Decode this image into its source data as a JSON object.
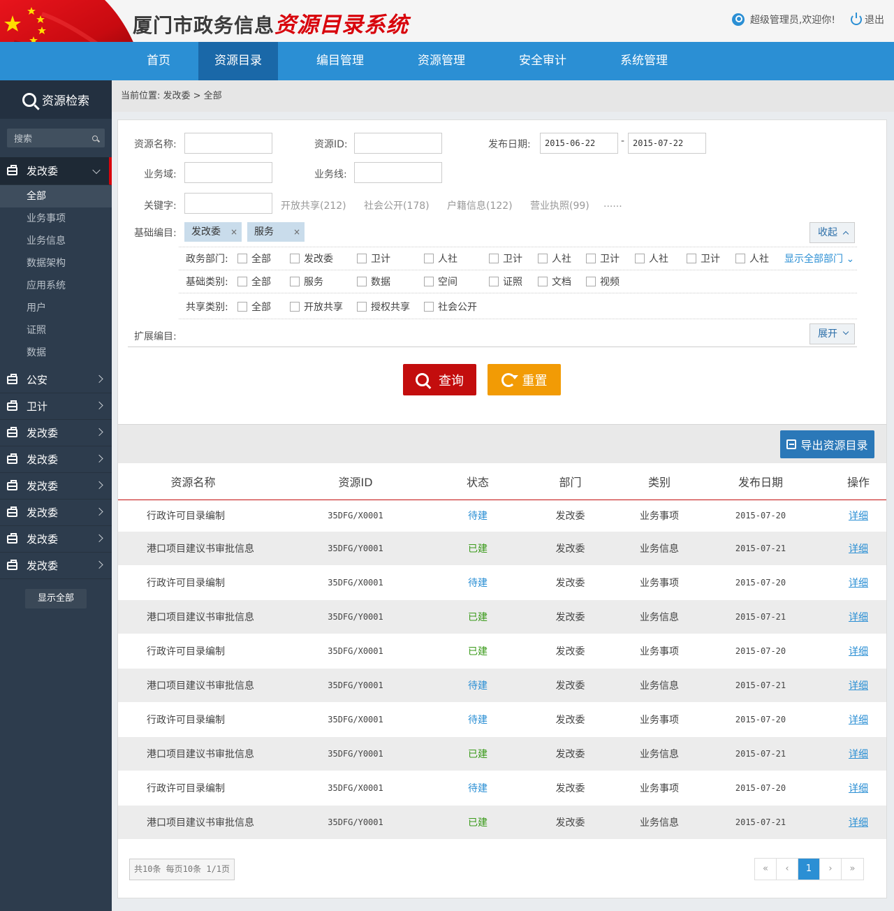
{
  "header": {
    "title_main": "厦门市政务信息",
    "title_accent": "资源目录系统",
    "user_text": "超级管理员,欢迎你!",
    "logout": "退出"
  },
  "nav": [
    "首页",
    "资源目录",
    "编目管理",
    "资源管理",
    "安全审计",
    "系统管理"
  ],
  "sidebar": {
    "title": "资源检索",
    "search_placeholder": "搜索",
    "open_group": "发改委",
    "sub_items": [
      "全部",
      "业务事项",
      "业务信息",
      "数据架构",
      "应用系统",
      "用户",
      "证照",
      "数据"
    ],
    "groups": [
      "公安",
      "卫计",
      "发改委",
      "发改委",
      "发改委",
      "发改委",
      "发改委",
      "发改委"
    ],
    "show_all": "显示全部"
  },
  "breadcrumb": "当前位置: 发改委 > 全部",
  "filters": {
    "name_label": "资源名称:",
    "id_label": "资源ID:",
    "date_label": "发布日期:",
    "date_from": "2015-06-22",
    "date_sep": "-",
    "date_to": "2015-07-22",
    "domain_label": "业务域:",
    "line_label": "业务线:",
    "keyword_label": "关键字:",
    "keywords": [
      "开放共享(212)",
      "社会公开(178)",
      "户籍信息(122)",
      "营业执照(99)",
      "......"
    ],
    "basic_label": "基础编目:",
    "chips": [
      "发改委",
      "服务"
    ],
    "chip_close": "×",
    "collapse": "收起",
    "dept_label": "政务部门:",
    "dept_options": [
      "全部",
      "发改委",
      "卫计",
      "人社",
      "卫计",
      "人社",
      "卫计",
      "人社",
      "卫计",
      "人社"
    ],
    "dept_more": "显示全部部门",
    "type_label": "基础类别:",
    "type_options": [
      "全部",
      "服务",
      "数据",
      "空间",
      "证照",
      "文档",
      "视频"
    ],
    "share_label": "共享类别:",
    "share_options": [
      "全部",
      "开放共享",
      "授权共享",
      "社会公开"
    ],
    "ext_label": "扩展编目:",
    "expand": "展开",
    "query": "查询",
    "reset": "重置"
  },
  "export": "导出资源目录",
  "table": {
    "headers": [
      "资源名称",
      "资源ID",
      "状态",
      "部门",
      "类别",
      "发布日期",
      "操作"
    ],
    "rows": [
      [
        "行政许可目录编制",
        "35DFG/X0001",
        "待建",
        "发改委",
        "业务事项",
        "2015-07-20",
        "详细"
      ],
      [
        "港口项目建议书审批信息",
        "35DFG/Y0001",
        "已建",
        "发改委",
        "业务信息",
        "2015-07-21",
        "详细"
      ],
      [
        "行政许可目录编制",
        "35DFG/X0001",
        "待建",
        "发改委",
        "业务事项",
        "2015-07-20",
        "详细"
      ],
      [
        "港口项目建议书审批信息",
        "35DFG/Y0001",
        "已建",
        "发改委",
        "业务信息",
        "2015-07-21",
        "详细"
      ],
      [
        "行政许可目录编制",
        "35DFG/X0001",
        "已建",
        "发改委",
        "业务事项",
        "2015-07-20",
        "详细"
      ],
      [
        "港口项目建议书审批信息",
        "35DFG/Y0001",
        "待建",
        "发改委",
        "业务信息",
        "2015-07-21",
        "详细"
      ],
      [
        "行政许可目录编制",
        "35DFG/X0001",
        "待建",
        "发改委",
        "业务事项",
        "2015-07-20",
        "详细"
      ],
      [
        "港口项目建议书审批信息",
        "35DFG/Y0001",
        "已建",
        "发改委",
        "业务信息",
        "2015-07-21",
        "详细"
      ],
      [
        "行政许可目录编制",
        "35DFG/X0001",
        "待建",
        "发改委",
        "业务事项",
        "2015-07-20",
        "详细"
      ],
      [
        "港口项目建议书审批信息",
        "35DFG/Y0001",
        "已建",
        "发改委",
        "业务信息",
        "2015-07-21",
        "详细"
      ]
    ]
  },
  "pagination": {
    "info": "共10条 每页10条 1/1页",
    "first": "«",
    "prev": "‹",
    "current": "1",
    "next": "›",
    "last": "»"
  },
  "colors": {
    "nav": "#2b8fd4",
    "nav_active": "#1a68a8",
    "sidebar": "#2d3c4d",
    "accent_red": "#d8040c",
    "query_btn": "#c30d0d",
    "reset_btn": "#f29b05",
    "pending": "#2b8fd4",
    "done": "#3a9a1a"
  }
}
